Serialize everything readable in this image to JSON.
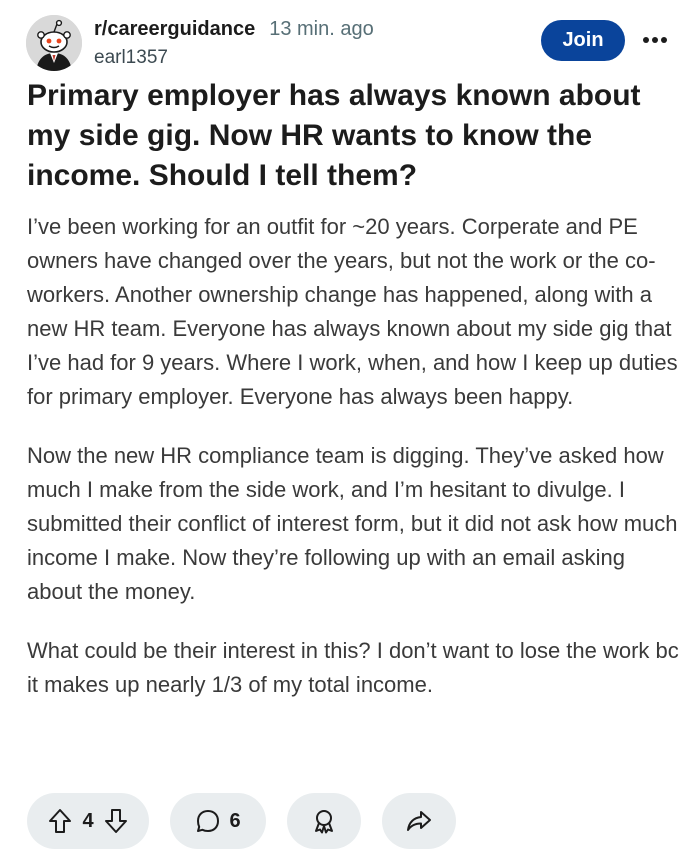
{
  "post": {
    "subreddit": "r/careerguidance",
    "time_ago": "13 min. ago",
    "username": "earl1357",
    "join_label": "Join",
    "title": "Primary employer has always known about my side gig. Now HR wants to know the income. Should I tell them?",
    "paragraphs": [
      "I’ve been working for an outfit for ~20 years. Corperate and PE owners have changed over the years, but not the work or the co-workers. Another ownership change has happened, along with a new HR team. Everyone has always known about my side gig that I’ve had for 9 years. Where I work, when, and how I keep up duties for primary employer. Everyone has always been happy.",
      "Now the new HR compliance team is digging. They’ve asked how much I make from the side work, and I’m hesitant to divulge. I submitted their conflict of interest form, but it did not ask how much income I make. Now they’re following up with an email asking about the money.",
      "What could be their interest in this? I don’t want to lose the work bc it makes up nearly 1/3 of my total income."
    ]
  },
  "actions": {
    "vote_count": "4",
    "comment_count": "6"
  },
  "icons": {
    "avatar": "snoo-avatar-icon",
    "more": "more-options-icon",
    "upvote": "upvote-arrow-icon",
    "downvote": "downvote-arrow-icon",
    "comment": "comment-bubble-icon",
    "award": "award-icon",
    "share": "share-arrow-icon"
  },
  "colors": {
    "join_button": "#0a449b",
    "action_pill": "#e9edef"
  }
}
